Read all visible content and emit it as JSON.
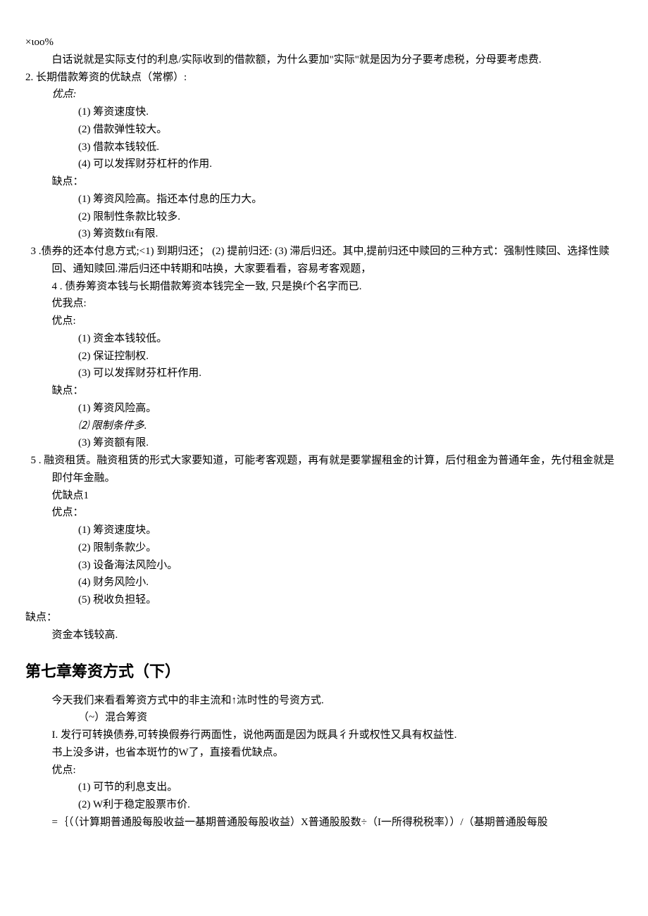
{
  "lines": {
    "l01": "×ιoo%",
    "l02": "白话说就是实际支付的利息/实际收到的借款额，为什么要加\"实际\"就是因为分子要考虑税，分母要考虑费.",
    "l03": "2. 长期借款筹资的优缺点（常槨）:",
    "l04": "优点:",
    "l05": "(1) 筹资速度快.",
    "l06": "(2) 借款弹性较大。",
    "l07": "(3) 借款本钱较低.",
    "l08": "(4) 可以发挥财芬杠杆的作用.",
    "l09": "缺点：",
    "l10": "(1)       筹资风险高。指还本付息的压力大。",
    "l11": "(2)       限制性条款比较多.",
    "l12": "(3)       筹资数fit有限.",
    "l13": "3 .债券的还本付息方式;<1) 到期归还； (2) 提前归还:  (3) 滞后归还。其中,提前归还中赎回的三种方式：强制性赎回、选择性赎回、通知赎回.滞后归还中转期和咕换，大家要看看，容易考客观题，",
    "l14": "4         . 债券筹资本钱与长期借款筹资本钱完全一致, 只是换f个名字而已.",
    "l15": "优我点:",
    "l16": "优点:",
    "l17": "(1) 资金本钱较低。",
    "l18": "(2) 保证控制权.",
    "l19": "(3) 可以发挥财芬杠杆作用.",
    "l20": "缺点：",
    "l21": "(1) 筹资风险高。",
    "l22": "⑵ 限制条件多.",
    "l23": "(3) 筹资额有限.",
    "l24": "5 . 融资租赁。融资租赁的形式大家要知道，可能考客观题，再有就是要掌握租金的计算，后付租金为普通年金，先付租金就是即付年金融。",
    "l25": "优缺点1",
    "l26": "优点：",
    "l27": "(1) 筹资速度块。",
    "l28": "(2) 限制条款少。",
    "l29": "(3) 设备海法风险小。",
    "l30": "(4) 财务风险小.",
    "l31": "(5) 税收负担轻。",
    "l32": "缺点：",
    "l33": "资金本钱较高.",
    "h2": "第七章筹资方式（下）",
    "l34": "今天我们来看看筹资方式中的非主流和↑㳈时性的号资方式.",
    "l35": "（~）混合筹资",
    "l36": "I. 发行可转换债券,可转换假券行两面性，说他两面是因为既具彳升或权性又具有权益性.",
    "l37": "书上没多讲，也省本斑竹的W了，直接看优缺点。",
    "l38": "优点:",
    "l39": "(1) 可节的利息支出。",
    "l40": "(2) W利于稳定股票市价.",
    "l41": "=｛（（计算期普通股每股收益一基期普通股每股收益）X普通股股数÷（I一所得税税率））/（基期普通股每股"
  }
}
